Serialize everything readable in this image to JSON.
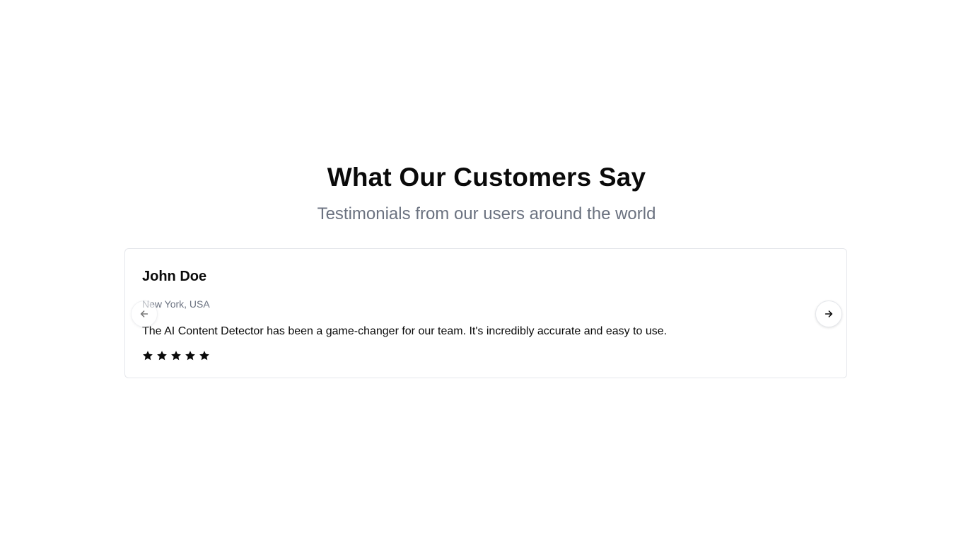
{
  "section": {
    "title": "What Our Customers Say",
    "subtitle": "Testimonials from our users around the world"
  },
  "testimonial": {
    "name": "John Doe",
    "location": "New York, USA",
    "quote": "The AI Content Detector has been a game-changer for our team. It's incredibly accurate and easy to use.",
    "rating": 5,
    "rating_max": 5
  },
  "carousel": {
    "prev_icon": "arrow-left-icon",
    "next_icon": "arrow-right-icon"
  },
  "colors": {
    "text_primary": "#0a0a0a",
    "text_muted": "#6b7280",
    "border": "#e5e7eb"
  }
}
